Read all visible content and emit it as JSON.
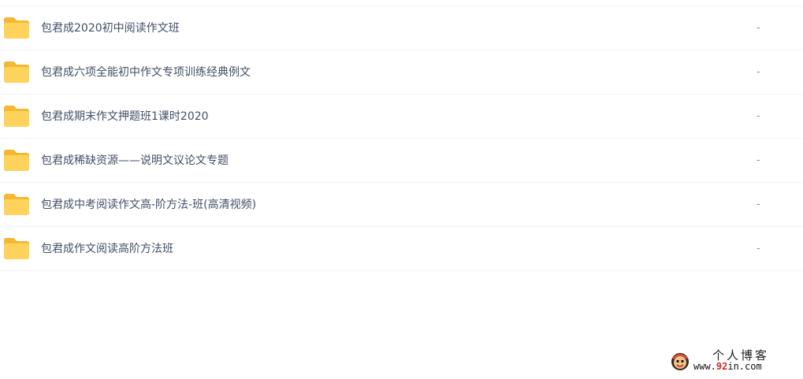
{
  "file_list": {
    "items": [
      {
        "name": "包君成2020初中阅读作文班",
        "size": "-"
      },
      {
        "name": "包君成六项全能初中作文专项训练经典例文",
        "size": "-"
      },
      {
        "name": "包君成期末作文押题班1课时2020",
        "size": "-"
      },
      {
        "name": "包君成稀缺资源——说明文议论文专题",
        "size": "-"
      },
      {
        "name": "包君成中考阅读作文高-阶方法-班(高清视频)",
        "size": "-"
      },
      {
        "name": "包君成作文阅读高阶方法班",
        "size": "-"
      }
    ]
  },
  "watermark": {
    "title": "个人博客",
    "url_prefix": "www.",
    "url_number": "92",
    "url_suffix": "in.com"
  },
  "colors": {
    "folder_body": "#ffd25c",
    "folder_tab": "#f5b833",
    "text": "#424e67",
    "divider": "#f1f2f4"
  }
}
